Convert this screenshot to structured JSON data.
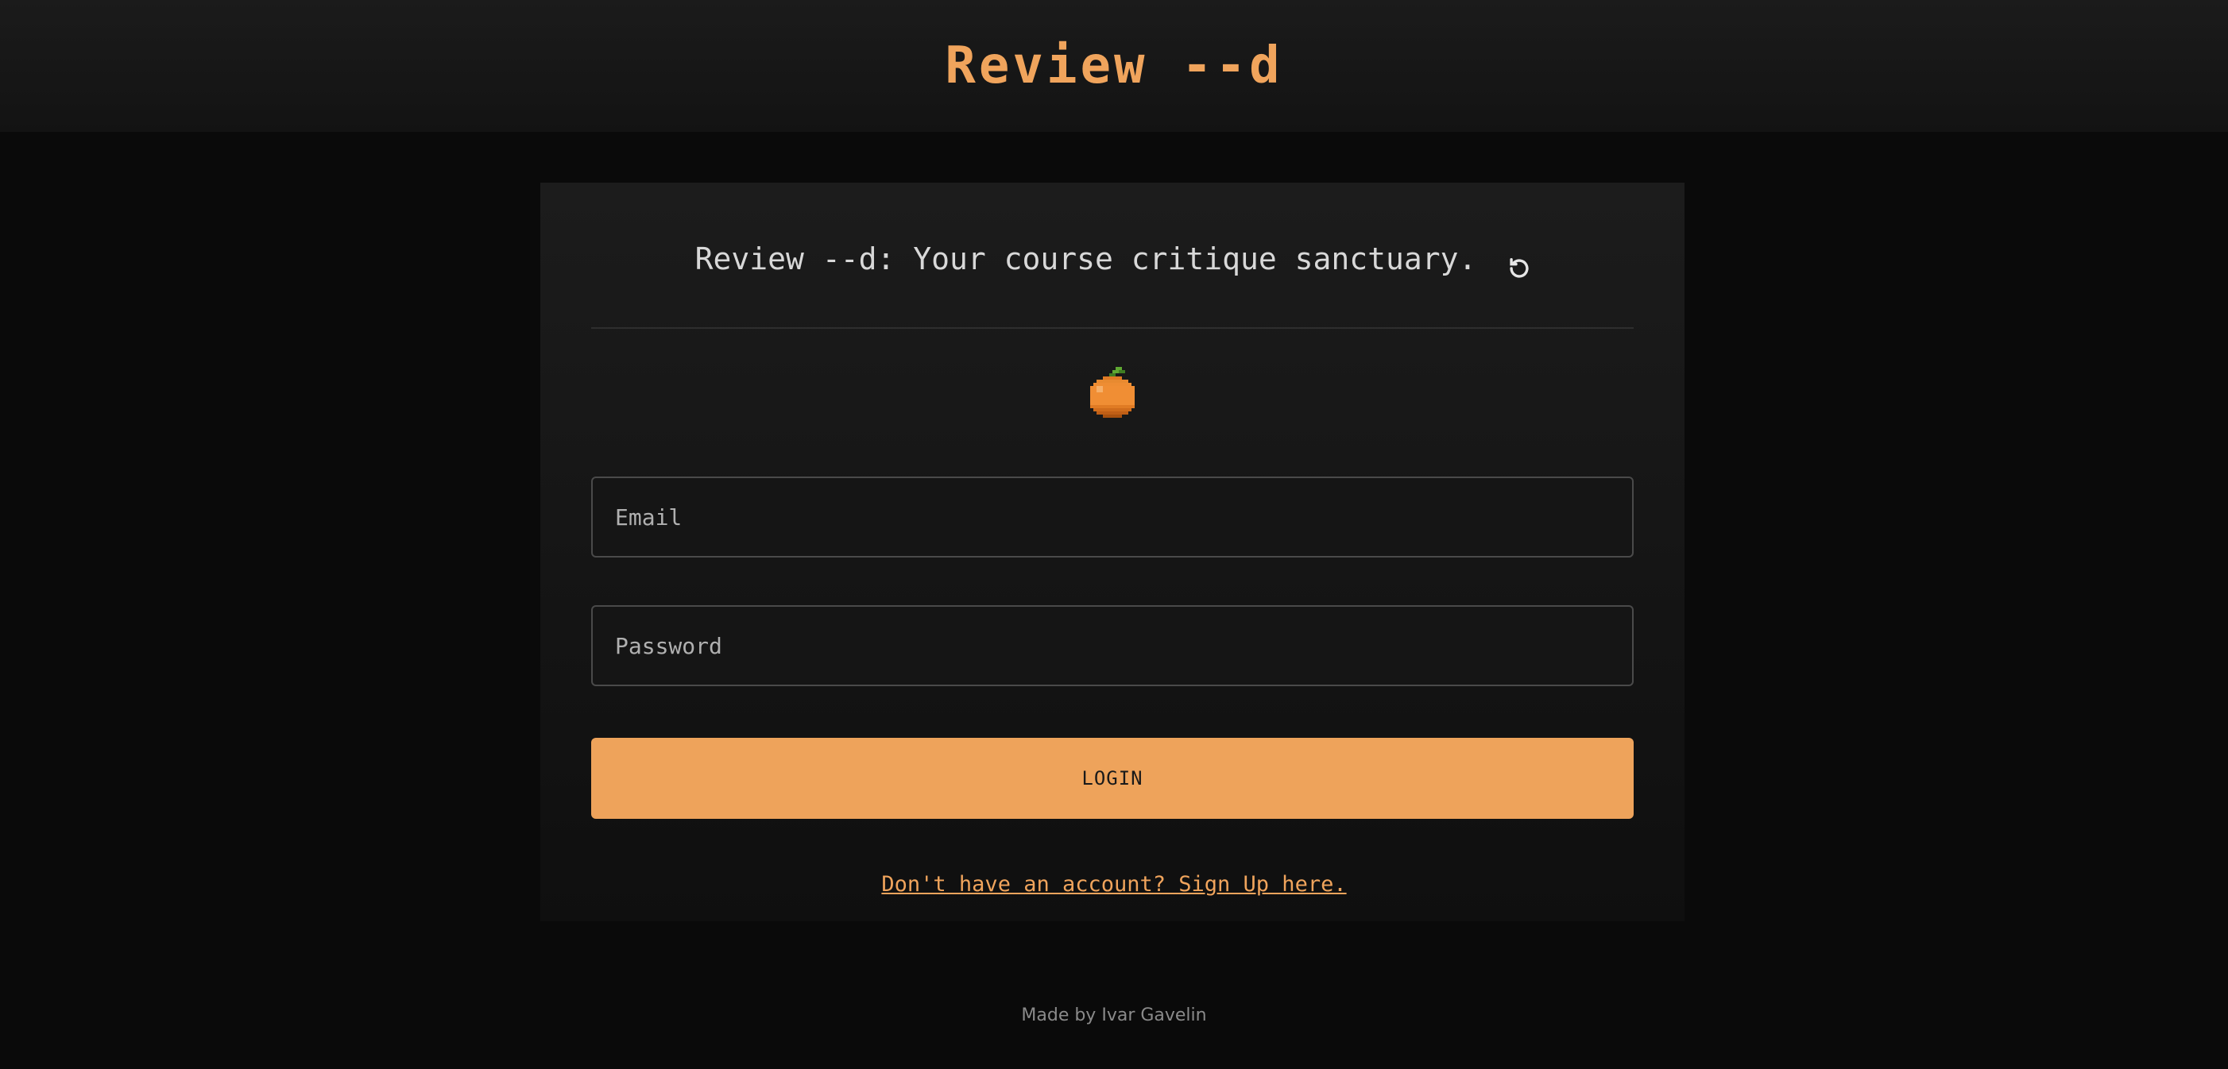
{
  "header": {
    "brand": "Review --d"
  },
  "card": {
    "tagline": "Review --d: Your course critique sanctuary.",
    "tagline_icon": "refresh-icon",
    "mascot_icon": "orange-fruit-icon"
  },
  "form": {
    "email_placeholder": "Email",
    "email_value": "",
    "password_placeholder": "Password",
    "password_value": "",
    "login_label": "LOGIN",
    "signup_link": "Don't have an account? Sign Up here."
  },
  "footer": {
    "credit": "Made by Ivar Gavelin"
  },
  "colors": {
    "accent": "#eea35b",
    "background": "#0a0a0a",
    "card": "#1a1a1a"
  }
}
